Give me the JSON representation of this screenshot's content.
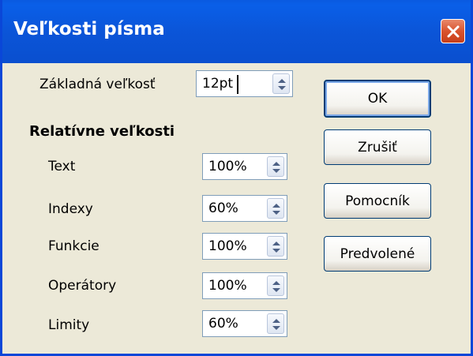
{
  "window": {
    "title": "Veľkosti písma"
  },
  "base_size": {
    "label": "Základná veľkosť",
    "value": "12pt"
  },
  "relative_group": {
    "title": "Relatívne veľkosti",
    "items": [
      {
        "label": "Text",
        "value": "100%"
      },
      {
        "label": "Indexy",
        "value": "60%"
      },
      {
        "label": "Funkcie",
        "value": "100%"
      },
      {
        "label": "Operátory",
        "value": "100%"
      },
      {
        "label": "Limity",
        "value": "60%"
      }
    ]
  },
  "buttons": {
    "ok": "OK",
    "cancel": "Zrušiť",
    "help": "Pomocník",
    "default": "Predvolené"
  },
  "icons": {
    "close": "close-icon",
    "spin": "spin-arrows-icon"
  }
}
